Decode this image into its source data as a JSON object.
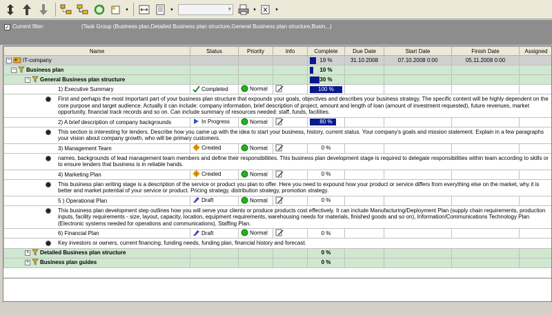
{
  "filter": {
    "checked": true,
    "label": "Current filter:",
    "value": "(Task Group  (Business plan,Detailed Business plan structure,General Business plan structure,Busin...)"
  },
  "columns": [
    "Name",
    "Status",
    "Priority",
    "Info",
    "Complete",
    "Due Date",
    "Start Date",
    "Finish Date",
    "Assigned"
  ],
  "company": {
    "name": "IT-company",
    "complete": "19 %",
    "complete_value": 19,
    "due": "31.10.2008",
    "start": "07.10.2008 0:00",
    "finish": "05.11.2008 0:00"
  },
  "groups": {
    "business_plan": {
      "name": "Business plan",
      "complete": "10 %",
      "complete_value": 10
    },
    "general": {
      "name": "General Business plan structure",
      "complete": "30 %",
      "complete_value": 30
    },
    "detailed": {
      "name": "Detailed Business plan structure",
      "complete": "0 %",
      "complete_value": 0
    },
    "guides": {
      "name": "Business plan guides",
      "complete": "0 %",
      "complete_value": 0
    }
  },
  "tasks": [
    {
      "name": "1) Executive Summary",
      "status": "Completed",
      "priority": "Normal",
      "complete": "100 %",
      "complete_value": 100,
      "desc": "First and perhaps the most important part of your business plan structure that expounds your goals, objectives and describes your business strategy. The specific content will be highly dependent on the core purpose and target audience. Actually it can include: company information, brief description of project, amount and length of loan (amount of investment requested), future revenues, market opportunity, financial track records and so on. Can include summary of resources needed: staff, funds, facilities."
    },
    {
      "name": "2) A brief description of company backgrounds",
      "status": "In Progress",
      "priority": "Normal",
      "complete": "80 %",
      "complete_value": 80,
      "desc": "This section is interesting for lenders. Describe how you came up with the idea to start your business, history, current status. Your company's goals and mission statement. Explain in a few paragraphs your vision about company growth, who will be primary customers."
    },
    {
      "name": "3) Management Team",
      "status": "Created",
      "priority": "Normal",
      "complete": "0 %",
      "complete_value": 0,
      "desc": "names, backgrounds of lead management team members and define their responsibilities. This business plan development stage is required to delegate responsibilities within team according to skills or to ensure lenders that business is in reliable hands."
    },
    {
      "name": "4) Marketing Plan",
      "status": "Created",
      "priority": "Normal",
      "complete": "0 %",
      "complete_value": 0,
      "desc": "This business plan writing stage is a description of the service or product you plan to offer. Here you need to expound how your product or service differs from everything else on the market, why it is better and market potential of your service or product. Pricing strategy, distribution strategy, promotion strategy."
    },
    {
      "name": "5 ) Operational Plan",
      "status": "Draft",
      "priority": "Normal",
      "complete": "0 %",
      "complete_value": 0,
      "desc": "This business plan development step outlines how you will serve your clients or produce products cost effectively. It can include Manufacturing/Deployment Plan (supply chain requirements, production inputs, facility requirements - size, layout, capacity, location, equipment requirements, warehousing needs for materials, finished goods and so on), Information/Communications Technology Plan (Electronic systems needed for operations and communications), Staffing Plan."
    },
    {
      "name": "6) Financial Plan",
      "status": "Draft",
      "priority": "Normal",
      "complete": "0 %",
      "complete_value": 0,
      "desc": "Key investors or owners, current financing, funding needs, funding plan, financial history and forecast."
    }
  ],
  "colors": {
    "group_bg": "#cfe8cf",
    "progress": "#0a1a8c",
    "filter_bg": "#8d8d8d"
  }
}
